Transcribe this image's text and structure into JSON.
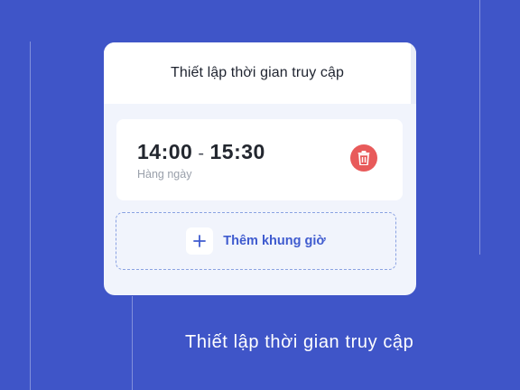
{
  "dialog": {
    "title": "Thiết lập thời gian truy cập"
  },
  "time_slot": {
    "start": "14:00",
    "separator": "-",
    "end": "15:30",
    "repeat": "Hàng ngày",
    "delete_icon": "trash-icon"
  },
  "add_slot": {
    "icon": "plus-icon",
    "label": "Thêm khung giờ"
  },
  "caption": "Thiết lập thời gian truy cập",
  "colors": {
    "background": "#3f55c8",
    "accent": "#3f5bcf",
    "danger": "#e85a5a"
  }
}
